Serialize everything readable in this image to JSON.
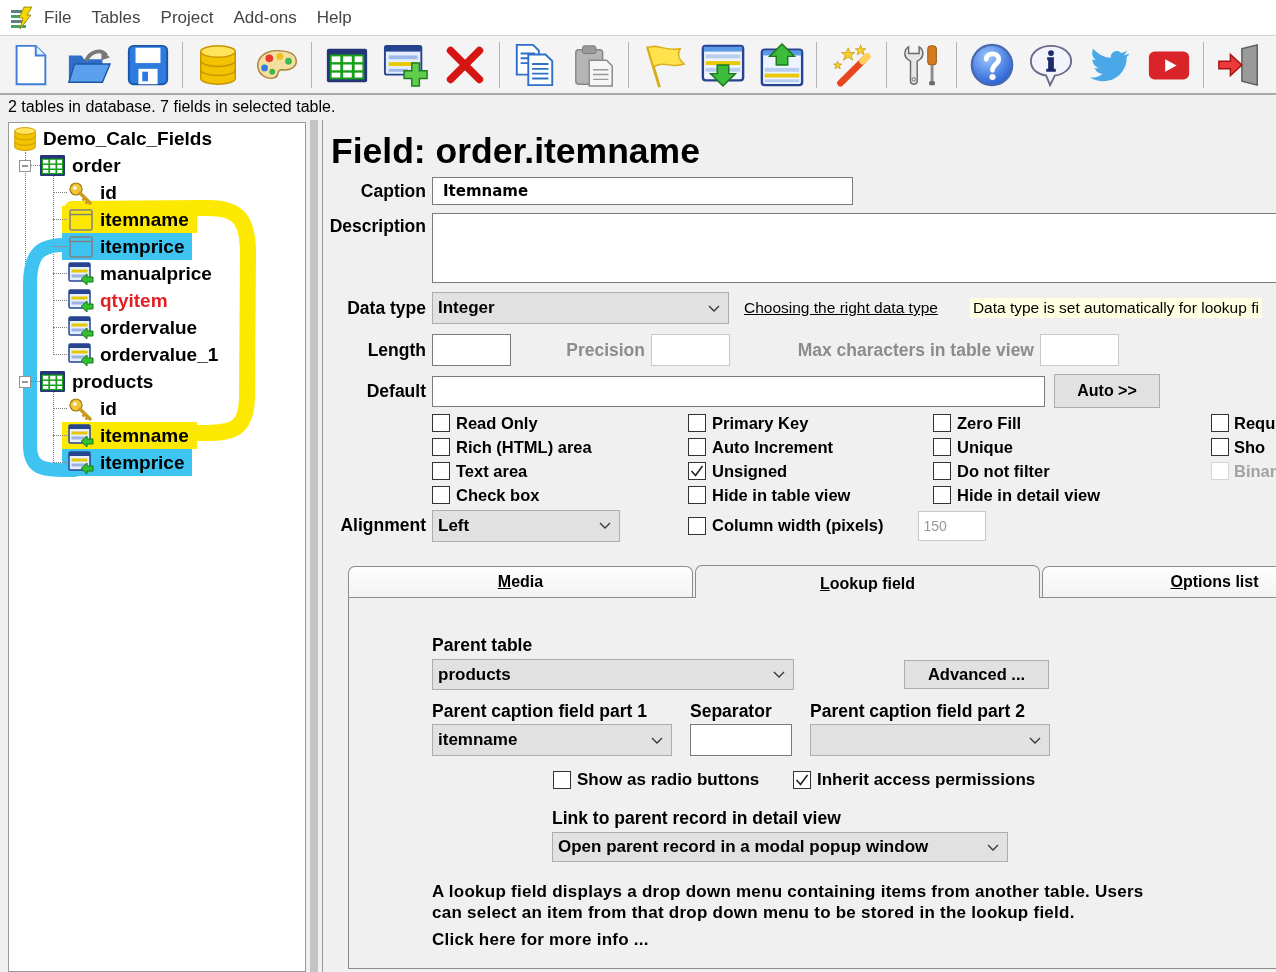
{
  "menu": [
    "File",
    "Tables",
    "Project",
    "Add-ons",
    "Help"
  ],
  "status_text": "2 tables in database. 7 fields in selected table.",
  "tree": {
    "root": "Demo_Calc_Fields",
    "tables": [
      {
        "label": "order",
        "expanded": true,
        "children": [
          {
            "label": "id",
            "kind": "key",
            "color": "#000000"
          },
          {
            "label": "itemname",
            "kind": "plain",
            "color": "#000000",
            "highlight": {
              "color": "#fde800"
            }
          },
          {
            "label": "itemprice",
            "kind": "plain",
            "color": "#000000",
            "highlight": {
              "color": "#3fc4f2"
            }
          },
          {
            "label": "manualprice",
            "kind": "list",
            "color": "#000000"
          },
          {
            "label": "qtyitem",
            "kind": "list",
            "color": "#e31e24"
          },
          {
            "label": "ordervalue",
            "kind": "list",
            "color": "#000000"
          },
          {
            "label": "ordervalue_1",
            "kind": "list",
            "color": "#000000"
          }
        ]
      },
      {
        "label": "products",
        "expanded": true,
        "children": [
          {
            "label": "id",
            "kind": "key",
            "color": "#000000"
          },
          {
            "label": "itemname",
            "kind": "list",
            "color": "#000000",
            "highlight": {
              "color": "#fde800"
            }
          },
          {
            "label": "itemprice",
            "kind": "list",
            "color": "#000000",
            "highlight": {
              "color": "#3fc4f2"
            }
          }
        ]
      }
    ]
  },
  "annotations": [
    {
      "kind": "right-loop",
      "color": "#fde800"
    },
    {
      "kind": "left-loop",
      "color": "#3fc4f2"
    }
  ],
  "field": {
    "title": "Field: order.itemname",
    "caption": {
      "label": "Caption",
      "value": "Itemname"
    },
    "description": {
      "label": "Description"
    },
    "data_type": {
      "label": "Data type",
      "value": "Integer",
      "link": "Choosing the right data type",
      "hint": "Data type is set automatically for lookup fi"
    },
    "length": {
      "label": "Length",
      "disabled": false
    },
    "precision": {
      "label": "Precision",
      "disabled": true
    },
    "max_chars": {
      "label": "Max characters in table view",
      "disabled": true
    },
    "default": {
      "label": "Default",
      "button": "Auto >>"
    },
    "options": [
      [
        {
          "label": "Read Only",
          "checked": false,
          "disabled": false
        },
        {
          "label": "Rich (HTML) area",
          "checked": false,
          "disabled": false
        },
        {
          "label": "Text area",
          "checked": false,
          "disabled": false
        },
        {
          "label": "Check box",
          "checked": false,
          "disabled": false
        }
      ],
      [
        {
          "label": "Primary Key",
          "checked": false,
          "disabled": false
        },
        {
          "label": "Auto Increment",
          "checked": false,
          "disabled": false
        },
        {
          "label": "Unsigned",
          "checked": true,
          "disabled": false
        },
        {
          "label": "Hide in table view",
          "checked": false,
          "disabled": false
        }
      ],
      [
        {
          "label": "Zero Fill",
          "checked": false,
          "disabled": false
        },
        {
          "label": "Unique",
          "checked": false,
          "disabled": false
        },
        {
          "label": "Do not filter",
          "checked": false,
          "disabled": false
        },
        {
          "label": "Hide in detail view",
          "checked": false,
          "disabled": false
        }
      ],
      [
        {
          "label": "Requ",
          "checked": false,
          "disabled": false
        },
        {
          "label": "Sho",
          "checked": false,
          "disabled": false
        },
        {
          "label": "Binar",
          "checked": false,
          "disabled": true
        }
      ]
    ],
    "alignment": {
      "label": "Alignment",
      "value": "Left"
    },
    "column_width": {
      "label": "Column width (pixels)",
      "checked": false,
      "value": "150"
    }
  },
  "tabs": [
    {
      "label": "Media",
      "selected": false
    },
    {
      "label": "Lookup field",
      "selected": true
    },
    {
      "label": "Options list",
      "selected": false
    }
  ],
  "lookup": {
    "parent_table": {
      "label": "Parent table",
      "value": "products"
    },
    "advanced_button": "Advanced ...",
    "caption_part1": {
      "label": "Parent caption field part 1",
      "value": "itemname"
    },
    "separator": {
      "label": "Separator"
    },
    "caption_part2": {
      "label": "Parent caption field part 2"
    },
    "options": [
      {
        "label": "Show as radio buttons",
        "checked": false
      },
      {
        "label": "Inherit access permissions",
        "checked": true
      }
    ],
    "link_mode": {
      "label": "Link to parent record in detail view",
      "value": "Open parent record in a modal popup window"
    },
    "description": "A lookup field displays a drop down menu containing items from another table. Users can select an item from that drop down menu to be stored in the lookup field.",
    "more_info": "Click here for more info ..."
  }
}
